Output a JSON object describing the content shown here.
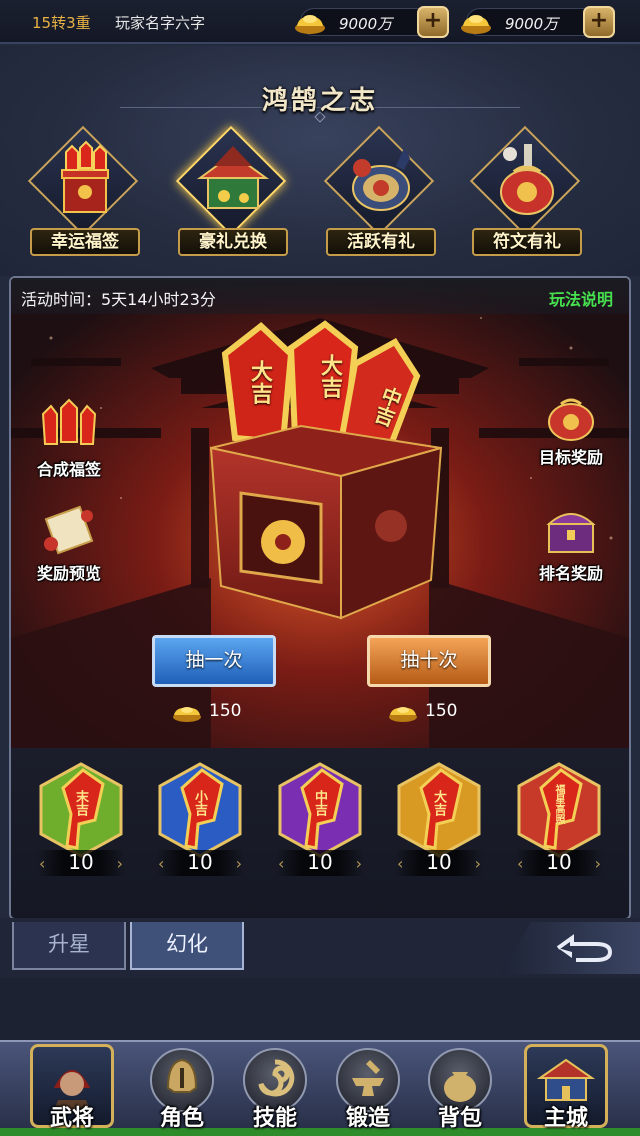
{
  "topbar": {
    "rank": "15转3重",
    "player_name": "玩家名字六字",
    "currency_1": {
      "icon": "gold-ingot-icon",
      "value": "9000万"
    },
    "currency_2": {
      "icon": "gold-ingot-icon",
      "value": "9000万"
    }
  },
  "header": {
    "title": "鸿鹄之志",
    "features": [
      {
        "label": "幸运福签",
        "icon": "lucky-lots-box-icon"
      },
      {
        "label": "豪礼兑换",
        "icon": "gift-pagoda-icon",
        "selected": true
      },
      {
        "label": "活跃有礼",
        "icon": "drum-toy-icon"
      },
      {
        "label": "符文有礼",
        "icon": "treasure-bag-icon"
      }
    ]
  },
  "activity": {
    "time_text": "活动时间：5天14小时23分",
    "rules_link": "玩法说明"
  },
  "side_buttons": {
    "combine": "合成福签",
    "target_reward": "目标奖励",
    "reward_preview": "奖励预览",
    "rank_reward": "排名奖励"
  },
  "box": {
    "lot_1": "大吉",
    "lot_2": "大吉",
    "lot_3": "中吉"
  },
  "draw": {
    "once_label": "抽一次",
    "once_cost": "150",
    "ten_label": "抽十次",
    "ten_cost": "150"
  },
  "lots": [
    {
      "text": "末吉",
      "count": "10",
      "color": "#6fae2d"
    },
    {
      "text": "小吉",
      "count": "10",
      "color": "#2a5cc4"
    },
    {
      "text": "中吉",
      "count": "10",
      "color": "#7a2fb3"
    },
    {
      "text": "大吉",
      "count": "10",
      "color": "#d89a22"
    },
    {
      "text": "福星高照",
      "count": "10",
      "color": "#c73a2a"
    }
  ],
  "tabs": {
    "star": "升星",
    "illusion": "幻化"
  },
  "nav": {
    "general": "武将",
    "character": "角色",
    "skills": "技能",
    "forge": "锻造",
    "bag": "背包",
    "main_city": "主城"
  }
}
